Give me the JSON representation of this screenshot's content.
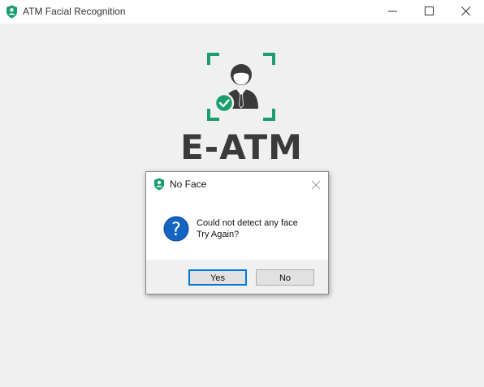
{
  "window": {
    "title": "ATM Facial Recognition"
  },
  "brand": {
    "text": "E-ATM"
  },
  "dialog": {
    "title": "No Face",
    "message_line1": "Could not detect any face",
    "message_line2": "Try Again?",
    "yes_label": "Yes",
    "no_label": "No"
  },
  "colors": {
    "accent_green": "#1a9e6e",
    "brand_text": "#3a3a3a",
    "question_blue": "#1565c0",
    "focus_border": "#0078d7"
  },
  "icons": {
    "app": "shield-icon",
    "logo": "face-recognition-icon",
    "dialog_question": "question-icon"
  }
}
